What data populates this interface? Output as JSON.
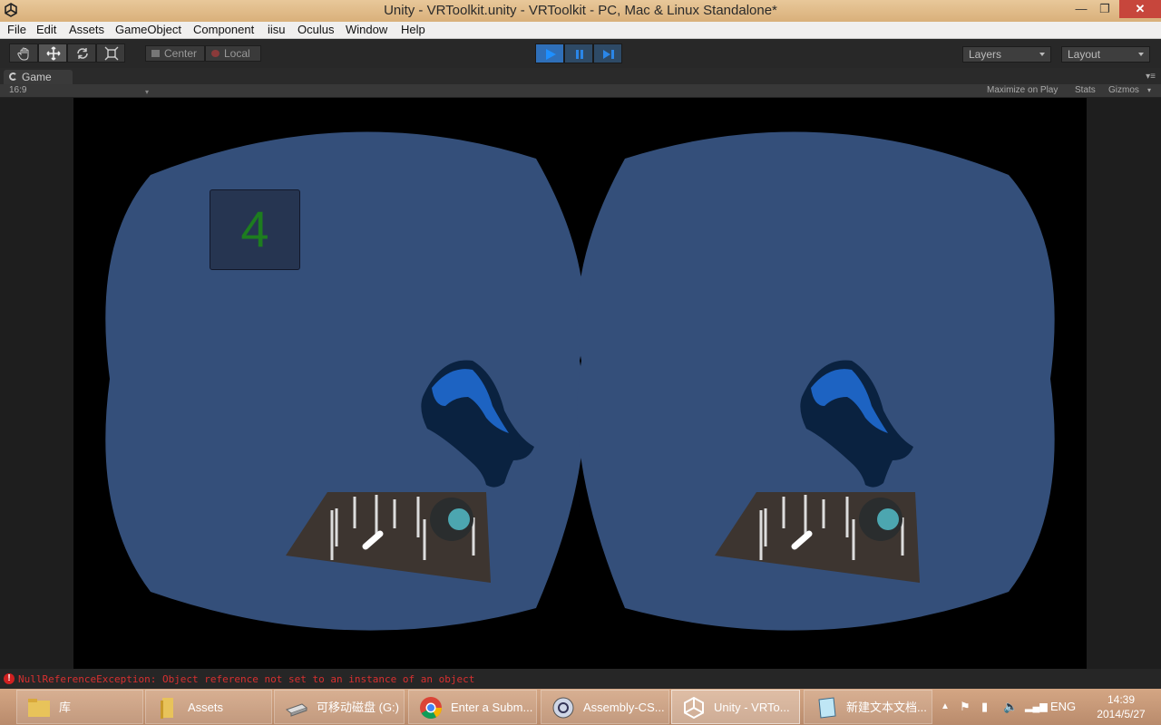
{
  "window": {
    "title": "Unity - VRToolkit.unity - VRToolkit - PC, Mac & Linux Standalone*",
    "minimize_icon": "minimize-icon",
    "maximize_icon": "restore-icon",
    "close_icon": "close-icon",
    "minimize_glyph": "—",
    "maximize_glyph": "❐",
    "close_glyph": "✕"
  },
  "menubar": {
    "items": [
      "File",
      "Edit",
      "Assets",
      "GameObject",
      "Component",
      "iisu",
      "Oculus",
      "Window",
      "Help"
    ]
  },
  "toolbar": {
    "tools": [
      "hand-icon",
      "move-icon",
      "rotate-icon",
      "scale-icon"
    ],
    "active_tool": "move-icon",
    "pivot_label": "Center",
    "space_label": "Local",
    "play_state": "playing",
    "layers_label": "Layers",
    "layout_label": "Layout"
  },
  "game_panel": {
    "tab_label": "Game",
    "aspect_label": "16:9",
    "maximize_on_play_label": "Maximize on Play",
    "stats_label": "Stats",
    "gizmos_label": "Gizmos",
    "counter_value": "4",
    "background_color": "#344f7a",
    "counter_color": "#1d7d1f"
  },
  "console": {
    "message": "NullReferenceException: Object reference not set to an instance of an object"
  },
  "taskbar": {
    "items": [
      {
        "label": "库",
        "icon": "library-folder-icon"
      },
      {
        "label": "Assets",
        "icon": "folder-icon"
      },
      {
        "label": "可移动磁盘 (G:)",
        "icon": "removable-drive-icon"
      },
      {
        "label": "Enter a Subm...",
        "icon": "chrome-icon"
      },
      {
        "label": "Assembly-CS...",
        "icon": "monodevelop-icon"
      },
      {
        "label": "Unity - VRTo...",
        "icon": "unity-icon"
      },
      {
        "label": "新建文本文档...",
        "icon": "notepad-icon"
      }
    ],
    "active_index": 5,
    "language": "ENG",
    "time": "14:39",
    "date": "2014/5/27"
  }
}
